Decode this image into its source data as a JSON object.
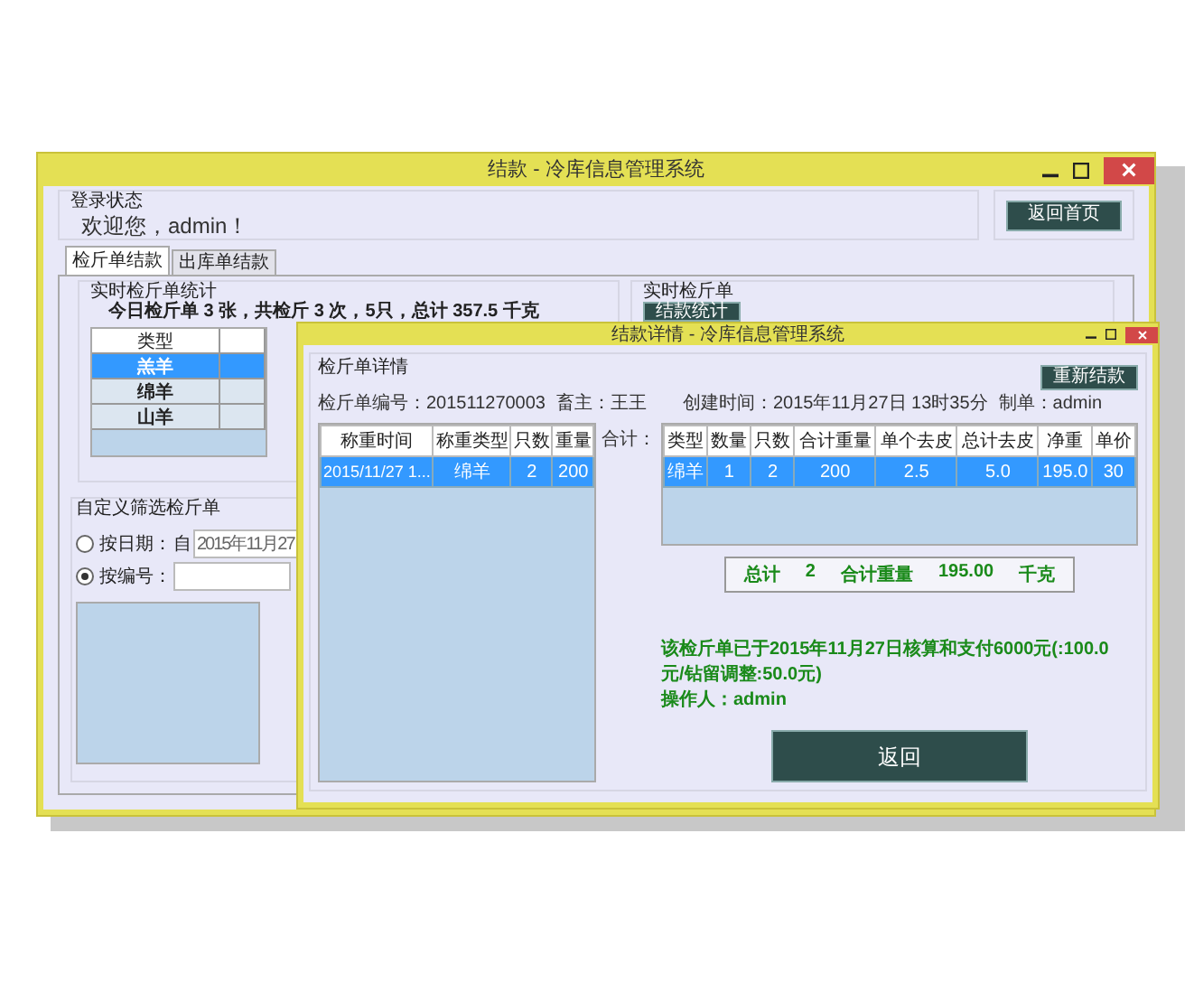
{
  "main_window": {
    "title": "结款 - 冷库信息管理系统"
  },
  "login_status": {
    "label": "登录状态",
    "welcome": "欢迎您，admin！"
  },
  "home_button": "返回首页",
  "tabs": [
    {
      "label": "检斤单结款",
      "selected": true
    },
    {
      "label": "出库单结款",
      "selected": false
    }
  ],
  "stats": {
    "title": "实时检斤单统计",
    "summary": "今日检斤单 3 张，共检斤 3 次，5只，总计 357.5 千克",
    "column": "类型",
    "rows": [
      {
        "type": "羔羊",
        "selected": true
      },
      {
        "type": "绵羊",
        "selected": false
      },
      {
        "type": "山羊",
        "selected": false
      }
    ]
  },
  "realtime": {
    "title": "实时检斤单",
    "button": "结款统计"
  },
  "filter": {
    "title": "自定义筛选检斤单",
    "options": [
      {
        "label": "按日期：",
        "selected": false
      },
      {
        "label": "按编号：",
        "selected": true
      }
    ],
    "from_label": "自",
    "date_value": "2015年11月27"
  },
  "detail_window": {
    "title": "结款详情 - 冷库信息管理系统",
    "section": "检斤单详情",
    "info": [
      "检斤单编号：201511270003",
      "畜主：王王",
      "创建时间：2015年11月27日 13时35分",
      "制单：admin"
    ],
    "rebill_button": "重新结款",
    "weigh_table": {
      "columns": [
        "称重时间",
        "称重类型",
        "只数",
        "重量"
      ],
      "rows": [
        {
          "cells": [
            "2015/11/27 1...",
            "绵羊",
            "2",
            "200"
          ],
          "selected": true
        }
      ]
    },
    "total_label": "合计：",
    "summary_table": {
      "columns": [
        "类型",
        "数量",
        "只数",
        "合计重量",
        "单个去皮",
        "总计去皮",
        "净重",
        "单价"
      ],
      "rows": [
        {
          "cells": [
            "绵羊",
            "1",
            "2",
            "200",
            "2.5",
            "5.0",
            "195.0",
            "30"
          ],
          "selected": true
        }
      ]
    },
    "totals": [
      "总计",
      "2",
      "合计重量",
      "195.00",
      "千克"
    ],
    "note": "该检斤单已于2015年11月27日核算和支付6000元(:100.0元/钻留调整:50.0元)",
    "operator": "操作人：admin",
    "back_button": "返回"
  }
}
